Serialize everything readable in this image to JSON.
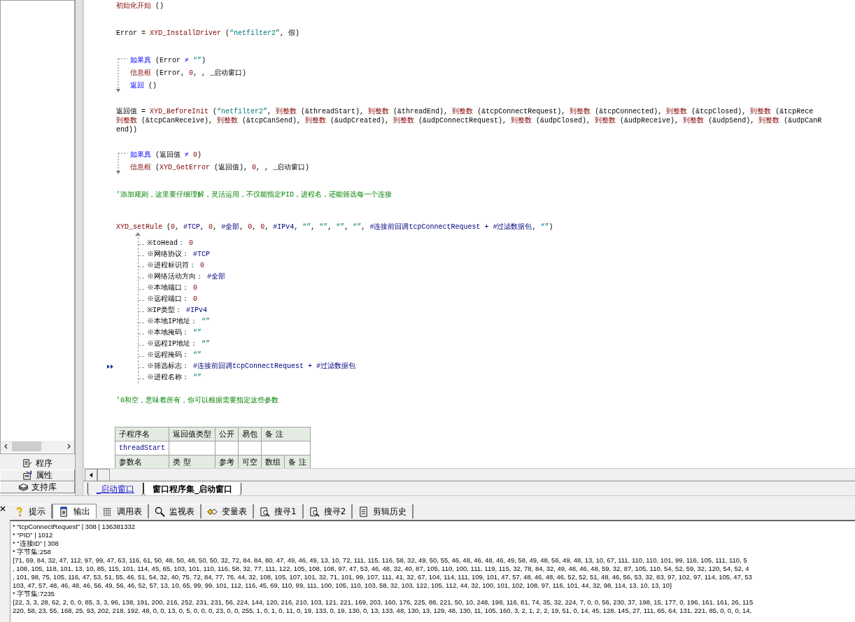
{
  "left_panel": {
    "tabs": [
      {
        "label": "程序",
        "selected": true
      },
      {
        "label": "属性",
        "selected": false
      },
      {
        "label": "支持库",
        "selected": false
      }
    ]
  },
  "editor": {
    "blocks": [
      {
        "kind": "plain",
        "lines": [
          [
            {
              "text": "初始化开始",
              "kind": "cmd"
            },
            {
              "text": " ()",
              "kind": "plain"
            }
          ]
        ]
      },
      {
        "kind": "plain",
        "lines": [
          [
            {
              "text": "Error = ",
              "kind": "plain"
            },
            {
              "text": "XYD_InstallDriver",
              "kind": "cmd"
            },
            {
              "text": " (",
              "kind": "plain"
            },
            {
              "text": "“netfilter2”",
              "kind": "str"
            },
            {
              "text": ", 假)",
              "kind": "plain"
            }
          ]
        ]
      },
      {
        "kind": "if",
        "lines": [
          [
            {
              "text": "如果真",
              "kind": "flow"
            },
            {
              "text": " (Error ",
              "kind": "plain"
            },
            {
              "text": "≠",
              "kind": "flow"
            },
            {
              "text": " “”",
              "kind": "str"
            },
            {
              "text": ")",
              "kind": "plain"
            }
          ],
          [
            {
              "text": "信息框",
              "kind": "cmd"
            },
            {
              "text": " (Error, ",
              "kind": "plain"
            },
            {
              "text": "0",
              "kind": "num"
            },
            {
              "text": ", , _启动窗口)",
              "kind": "plain"
            }
          ],
          [
            {
              "text": "返回",
              "kind": "flow"
            },
            {
              "text": " ()",
              "kind": "plain"
            }
          ]
        ]
      },
      {
        "kind": "wrap",
        "lines": [
          [
            {
              "text": "返回值 = ",
              "kind": "plain"
            },
            {
              "text": "XYD_BeforeInit",
              "kind": "cmd"
            },
            {
              "text": " (",
              "kind": "plain"
            },
            {
              "text": "“netfilter2”",
              "kind": "str"
            },
            {
              "text": ", ",
              "kind": "plain"
            },
            {
              "text": "到整数",
              "kind": "cmd"
            },
            {
              "text": " (&threadStart), ",
              "kind": "plain"
            },
            {
              "text": "到整数",
              "kind": "cmd"
            },
            {
              "text": " (&threadEnd), ",
              "kind": "plain"
            },
            {
              "text": "到整数",
              "kind": "cmd"
            },
            {
              "text": " (&tcpConnectRequest), ",
              "kind": "plain"
            },
            {
              "text": "到整数",
              "kind": "cmd"
            },
            {
              "text": " (&tcpConnected), ",
              "kind": "plain"
            },
            {
              "text": "到整数",
              "kind": "cmd"
            },
            {
              "text": " (&tcpClosed), ",
              "kind": "plain"
            },
            {
              "text": "到整数",
              "kind": "cmd"
            },
            {
              "text": " (&tcpRece",
              "kind": "plain"
            }
          ],
          [
            {
              "text": "到整数",
              "kind": "cmd"
            },
            {
              "text": " (&tcpCanReceive), ",
              "kind": "plain"
            },
            {
              "text": "到整数",
              "kind": "cmd"
            },
            {
              "text": " (&tcpCanSend), ",
              "kind": "plain"
            },
            {
              "text": "到整数",
              "kind": "cmd"
            },
            {
              "text": " (&udpCreated), ",
              "kind": "plain"
            },
            {
              "text": "到整数",
              "kind": "cmd"
            },
            {
              "text": " (&udpConnectRequest), ",
              "kind": "plain"
            },
            {
              "text": "到整数",
              "kind": "cmd"
            },
            {
              "text": " (&udpClosed), ",
              "kind": "plain"
            },
            {
              "text": "到整数",
              "kind": "cmd"
            },
            {
              "text": " (&udpReceive), ",
              "kind": "plain"
            },
            {
              "text": "到整数",
              "kind": "cmd"
            },
            {
              "text": " (&udpSend), ",
              "kind": "plain"
            },
            {
              "text": "到整数",
              "kind": "cmd"
            },
            {
              "text": " (&udpCanR",
              "kind": "plain"
            }
          ],
          [
            {
              "text": "end))",
              "kind": "plain"
            }
          ]
        ]
      },
      {
        "kind": "if",
        "lines": [
          [
            {
              "text": "如果真",
              "kind": "flow"
            },
            {
              "text": " (返回值 ",
              "kind": "plain"
            },
            {
              "text": "≠ ",
              "kind": "flow"
            },
            {
              "text": "0",
              "kind": "num"
            },
            {
              "text": ")",
              "kind": "plain"
            }
          ],
          [
            {
              "text": "信息框",
              "kind": "cmd"
            },
            {
              "text": " (",
              "kind": "plain"
            },
            {
              "text": "XYD_GetError",
              "kind": "cmd"
            },
            {
              "text": " (返回值), ",
              "kind": "plain"
            },
            {
              "text": "0",
              "kind": "num"
            },
            {
              "text": ", , _启动窗口)",
              "kind": "plain"
            }
          ]
        ]
      },
      {
        "kind": "comment",
        "lines": [
          [
            {
              "text": "’添加规则，这里要仔细理解，灵活运用，不仅能指定PID，进程名，还能筛选每一个连接",
              "kind": "comment"
            }
          ]
        ]
      },
      {
        "kind": "call",
        "lines": [
          [
            {
              "text": "XYD_setRule",
              "kind": "cmd"
            },
            {
              "text": " (",
              "kind": "plain"
            },
            {
              "text": "0",
              "kind": "num"
            },
            {
              "text": ", ",
              "kind": "plain"
            },
            {
              "text": "#TCP",
              "kind": "const"
            },
            {
              "text": ", ",
              "kind": "plain"
            },
            {
              "text": "0",
              "kind": "num"
            },
            {
              "text": ", ",
              "kind": "plain"
            },
            {
              "text": "#全部",
              "kind": "const"
            },
            {
              "text": ", ",
              "kind": "plain"
            },
            {
              "text": "0",
              "kind": "num"
            },
            {
              "text": ", ",
              "kind": "plain"
            },
            {
              "text": "0",
              "kind": "num"
            },
            {
              "text": ", ",
              "kind": "plain"
            },
            {
              "text": "#IPv4",
              "kind": "const"
            },
            {
              "text": ", ",
              "kind": "plain"
            },
            {
              "text": "“”",
              "kind": "str"
            },
            {
              "text": ", ",
              "kind": "plain"
            },
            {
              "text": "“”",
              "kind": "str"
            },
            {
              "text": ", ",
              "kind": "plain"
            },
            {
              "text": "“”",
              "kind": "str"
            },
            {
              "text": ", ",
              "kind": "plain"
            },
            {
              "text": "“”",
              "kind": "str"
            },
            {
              "text": ", ",
              "kind": "plain"
            },
            {
              "text": "#连接前回调tcpConnectRequest + #过滤数据包",
              "kind": "const"
            },
            {
              "text": ", ",
              "kind": "plain"
            },
            {
              "text": "“”",
              "kind": "str"
            },
            {
              "text": ")",
              "kind": "plain"
            }
          ]
        ],
        "params": [
          {
            "current": false,
            "segments": [
              {
                "text": "※toHead： ",
                "kind": "plain"
              },
              {
                "text": "0",
                "kind": "num"
              }
            ]
          },
          {
            "current": false,
            "segments": [
              {
                "text": "※网络协议： ",
                "kind": "plain"
              },
              {
                "text": "#TCP",
                "kind": "const"
              }
            ]
          },
          {
            "current": false,
            "segments": [
              {
                "text": "※进程标识符： ",
                "kind": "plain"
              },
              {
                "text": "0",
                "kind": "num"
              }
            ]
          },
          {
            "current": false,
            "segments": [
              {
                "text": "※网络活动方向： ",
                "kind": "plain"
              },
              {
                "text": "#全部",
                "kind": "const"
              }
            ]
          },
          {
            "current": false,
            "segments": [
              {
                "text": "※本地端口： ",
                "kind": "plain"
              },
              {
                "text": "0",
                "kind": "num"
              }
            ]
          },
          {
            "current": false,
            "segments": [
              {
                "text": "※远程端口： ",
                "kind": "plain"
              },
              {
                "text": "0",
                "kind": "num"
              }
            ]
          },
          {
            "current": false,
            "segments": [
              {
                "text": "※IP类型： ",
                "kind": "plain"
              },
              {
                "text": "#IPv4",
                "kind": "const"
              }
            ]
          },
          {
            "current": false,
            "segments": [
              {
                "text": "※本地IP地址： ",
                "kind": "plain"
              },
              {
                "text": "“”",
                "kind": "str"
              }
            ]
          },
          {
            "current": false,
            "segments": [
              {
                "text": "※本地掩码： ",
                "kind": "plain"
              },
              {
                "text": "“”",
                "kind": "str"
              }
            ]
          },
          {
            "current": false,
            "segments": [
              {
                "text": "※远程IP地址： ",
                "kind": "plain"
              },
              {
                "text": "“”",
                "kind": "str"
              }
            ]
          },
          {
            "current": false,
            "segments": [
              {
                "text": "※远程掩码： ",
                "kind": "plain"
              },
              {
                "text": "“”",
                "kind": "str"
              }
            ]
          },
          {
            "current": true,
            "segments": [
              {
                "text": "※筛选标志： ",
                "kind": "plain"
              },
              {
                "text": "#连接前回调tcpConnectRequest + #过滤数据包",
                "kind": "const"
              }
            ]
          },
          {
            "current": false,
            "segments": [
              {
                "text": "※进程名称： ",
                "kind": "plain"
              },
              {
                "text": "“”",
                "kind": "str"
              }
            ]
          }
        ]
      },
      {
        "kind": "comment",
        "lines": [
          [
            {
              "text": "’0和空，意味着所有，你可以根据需要指定这些参数",
              "kind": "comment"
            }
          ]
        ]
      }
    ],
    "table": {
      "header": [
        "子程序名",
        "返回值类型",
        "公开",
        "易包",
        "备 注"
      ],
      "subroutine": "threadStart",
      "param_header": [
        "参数名",
        "类 型",
        "参考",
        "可空",
        "数组",
        "备 注"
      ]
    },
    "file_tabs": [
      {
        "label": "_启动窗口",
        "selected": false
      },
      {
        "label": "窗口程序集_启动窗口",
        "selected": true
      }
    ]
  },
  "output_panel": {
    "tabs": [
      {
        "label": "提示",
        "selected": false
      },
      {
        "label": "输出",
        "selected": true
      },
      {
        "label": "调用表",
        "selected": false
      },
      {
        "label": "监视表",
        "selected": false
      },
      {
        "label": "变量表",
        "selected": false
      },
      {
        "label": "搜寻1",
        "selected": false
      },
      {
        "label": "搜寻2",
        "selected": false
      },
      {
        "label": "剪辑历史",
        "selected": false
      }
    ],
    "lines": [
      "* “tcpConnectRequest” | 308 | 136381332",
      "* “PID” | 1012",
      "* “连接ID” | 308",
      "* 字节集:258",
      "{71, 69, 84, 32, 47, 112, 97, 99, 47, 63, 116, 61, 50, 48, 50, 48, 50, 50, 32, 72, 84, 84, 80, 47, 49, 46, 49, 13, 10, 72, 111, 115, 116, 58, 32, 49, 50, 55, 46, 48, 46, 48, 46, 49, 58, 49, 48, 56, 49, 48, 13, 10, 67, 111, 110, 110, 101, 99, 116, 105, 111, 110, 5",
      ", 108, 105, 118, 101, 13, 10, 85, 115, 101, 114, 45, 65, 103, 101, 110, 116, 58, 32, 77, 111, 122, 105, 108, 108, 97, 47, 53, 46, 48, 32, 40, 87, 105, 110, 100, 111, 119, 115, 32, 78, 84, 32, 49, 48, 46, 48, 59, 32, 87, 105, 110, 54, 52, 59, 32, 120, 54, 52, 4",
      ", 101, 98, 75, 105, 116, 47, 53, 51, 55, 46, 51, 54, 32, 40, 75, 72, 84, 77, 76, 44, 32, 108, 105, 107, 101, 32, 71, 101, 99, 107, 111, 41, 32, 67, 104, 114, 111, 109, 101, 47, 57, 48, 46, 48, 46, 52, 52, 51, 48, 46, 56, 53, 32, 83, 97, 102, 97, 114, 105, 47, 53",
      "103, 47, 57, 48, 46, 48, 46, 56, 49, 56, 46, 52, 57, 13, 10, 65, 99, 99, 101, 112, 116, 45, 69, 110, 99, 111, 100, 105, 110, 103, 58, 32, 103, 122, 105, 112, 44, 32, 100, 101, 102, 108, 97, 116, 101, 44, 32, 98, 114, 13, 10, 13, 10}",
      "* 字节集:7235",
      "{22, 3, 3, 28, 62, 2, 0, 0, 85, 3, 3, 96, 138, 191, 200, 216, 252, 231, 231, 56, 224, 144, 120, 216, 210, 103, 121, 221, 169, 203, 160, 176, 225, 88, 221, 50, 10, 248, 198, 116, 81, 74, 35, 32, 224, 7, 0, 0, 56, 230, 37, 198, 15, 177, 0, 196, 161, 161, 26, 115",
      "220, 58, 23, 55, 168, 25, 93, 202, 218, 192, 48, 0, 0, 13, 0, 5, 0, 0, 0, 23, 0, 0, 255, 1, 0, 1, 0, 11, 0, 19, 133, 0, 19, 130, 0, 13, 133, 48, 130, 13, 129, 48, 130, 11, 105, 160, 3, 2, 1, 2, 2, 19, 51, 0, 14, 45, 128, 145, 27, 111, 65, 64, 131, 221, 85, 0, 0, 0, 14,"
    ]
  }
}
